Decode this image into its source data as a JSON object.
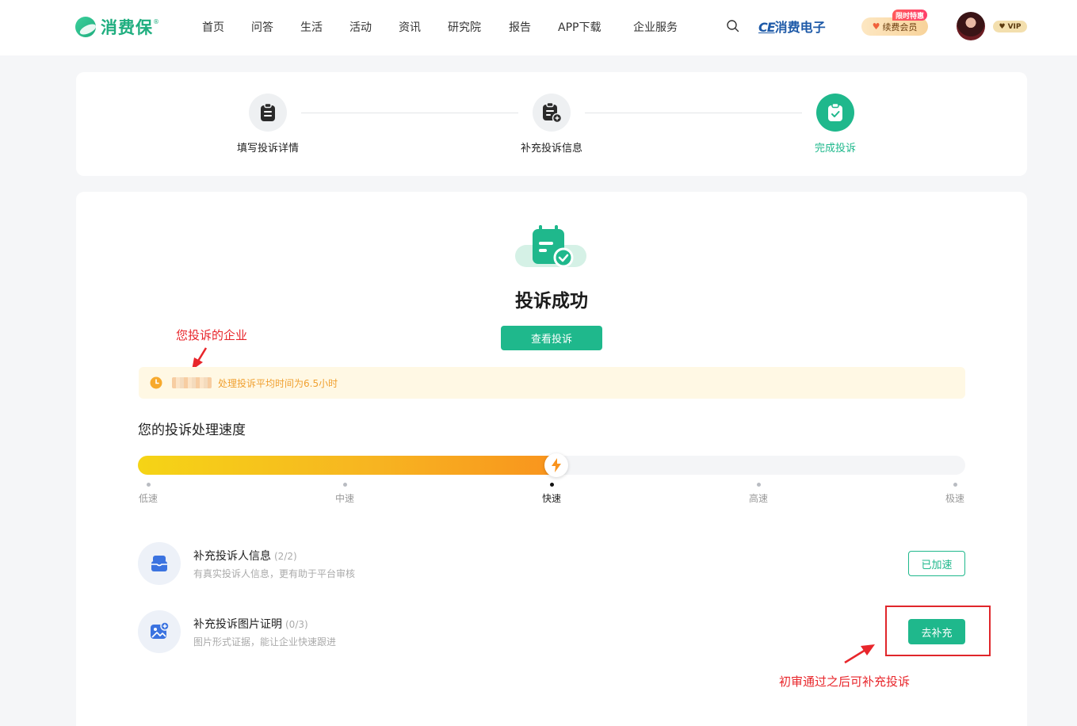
{
  "header": {
    "logo_text": "消费保",
    "logo_reg": "®",
    "nav": [
      "首页",
      "问答",
      "生活",
      "活动",
      "资讯",
      "研究院",
      "报告",
      "APP下载",
      "企业服务"
    ],
    "partner_prefix": "CE",
    "partner_name": "消费电子",
    "renew_label": "续费会员",
    "renew_tag": "限时特惠",
    "vip_label": "VIP"
  },
  "steps": [
    {
      "label": "填写投诉详情",
      "icon": "clipboard-icon",
      "active": false
    },
    {
      "label": "补充投诉信息",
      "icon": "clipboard-add-icon",
      "active": false
    },
    {
      "label": "完成投诉",
      "icon": "clipboard-check-icon",
      "active": true
    }
  ],
  "result": {
    "title": "投诉成功",
    "view_button": "查看投诉"
  },
  "annotations": {
    "company_note": "您投诉的企业",
    "supplement_note": "初审通过之后可补充投诉"
  },
  "notice": {
    "text": "处理投诉平均时间为6.5小时"
  },
  "speed": {
    "title": "您的投诉处理速度",
    "levels": [
      "低速",
      "中速",
      "快速",
      "高速",
      "极速"
    ],
    "current_level": "快速",
    "progress_fraction": 0.5
  },
  "tasks": [
    {
      "title": "补充投诉人信息",
      "count": "(2/2)",
      "desc": "有真实投诉人信息，更有助于平台审核",
      "button": "已加速",
      "icon": "id-card-icon"
    },
    {
      "title": "补充投诉图片证明",
      "count": "(0/3)",
      "desc": "图片形式证据，能让企业快速跟进",
      "button": "去补充",
      "icon": "image-add-icon"
    }
  ],
  "colors": {
    "brand": "#1fb88c",
    "accent_orange": "#f9931d",
    "annotation_red": "#e8262b"
  }
}
